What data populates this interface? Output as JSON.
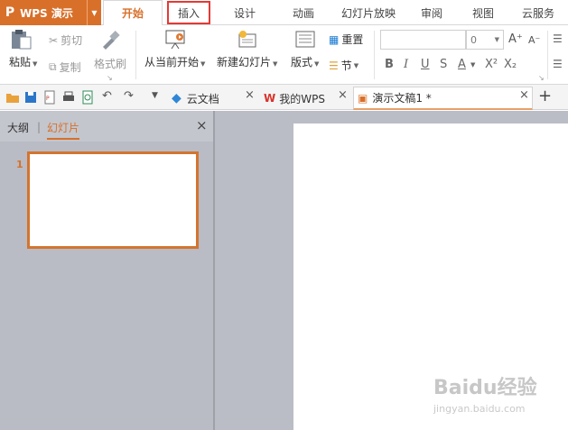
{
  "app": {
    "logo": "P",
    "name": "WPS 演示"
  },
  "menu_tabs": [
    "开始",
    "插入",
    "设计",
    "动画",
    "幻灯片放映",
    "审阅",
    "视图",
    "云服务"
  ],
  "ribbon": {
    "paste": "粘贴",
    "cut": "剪切",
    "copy": "复制",
    "format_painter": "格式刷",
    "from_current": "从当前开始",
    "new_slide": "新建幻灯片",
    "layout": "版式",
    "reset": "重置",
    "section": "节",
    "font_size": "0"
  },
  "doc_tabs": [
    {
      "label": "云文档"
    },
    {
      "label": "我的WPS"
    },
    {
      "label": "演示文稿1 *"
    }
  ],
  "left_pane": {
    "outline_tab": "大纲",
    "slides_tab": "幻灯片",
    "slide_number": "1"
  },
  "watermark": {
    "main": "Baidu经验",
    "sub": "jingyan.baidu.com"
  },
  "colors": {
    "accent": "#d8702a",
    "highlight": "#e53935",
    "pane_bg": "#b9bcc4"
  }
}
